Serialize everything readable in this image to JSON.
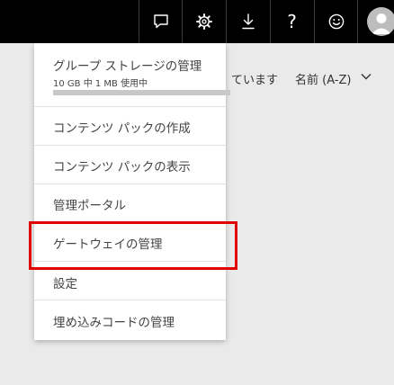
{
  "topbar": {
    "icons": [
      "comment-icon",
      "gear-icon",
      "download-icon",
      "help-icon",
      "smiley-icon",
      "avatar-icon"
    ],
    "help_glyph": "?"
  },
  "background": {
    "status_text": "ています",
    "sort_label": "名前 (A-Z)"
  },
  "menu": {
    "storage": {
      "label": "グループ ストレージの管理",
      "usage": "10 GB 中 1 MB 使用中",
      "usage_fraction": 0.0001
    },
    "items": [
      {
        "label": "コンテンツ パックの作成"
      },
      {
        "label": "コンテンツ パックの表示"
      },
      {
        "label": "管理ポータル"
      },
      {
        "label": "ゲートウェイの管理"
      },
      {
        "label": "設定"
      },
      {
        "label": "埋め込みコードの管理"
      }
    ]
  },
  "annotation": {
    "highlight_color": "#e00000"
  }
}
